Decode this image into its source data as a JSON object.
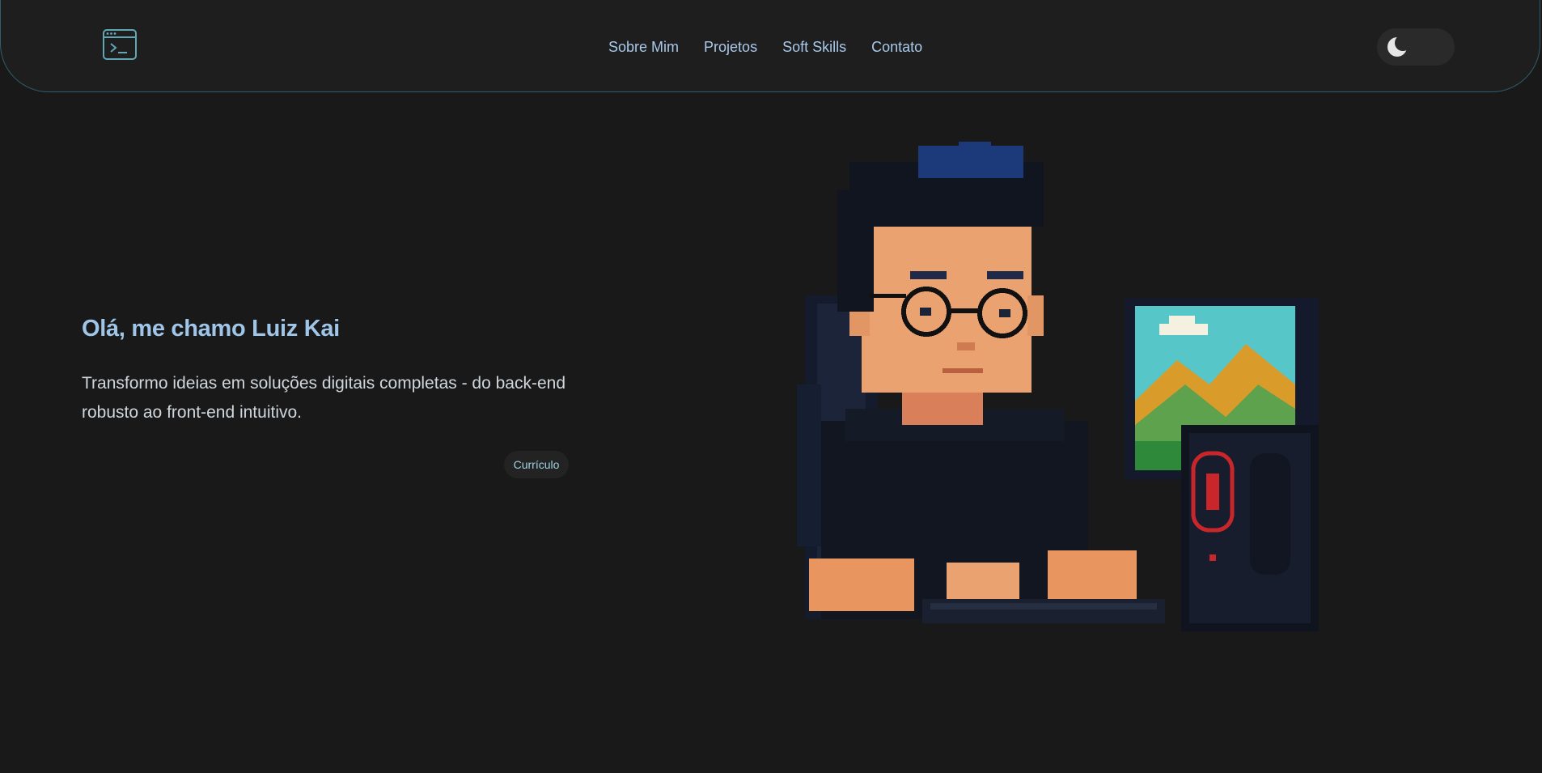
{
  "header": {
    "logo_icon": "terminal-icon",
    "nav": [
      {
        "label": "Sobre Mim"
      },
      {
        "label": "Projetos"
      },
      {
        "label": "Soft Skills"
      },
      {
        "label": "Contato"
      }
    ],
    "theme_toggle_icon": "moon-icon"
  },
  "hero": {
    "title": "Olá, me chamo Luiz Kai",
    "description": "Transformo ideias em soluções digitais completas - do back-end robusto ao front-end intuitivo.",
    "cv_button": "Currículo",
    "illustration": "pixel-art-developer-at-computer"
  },
  "colors": {
    "background": "#191919",
    "navbar": "#1e1e1e",
    "nav_border": "#2e5f6e",
    "accent": "#9fc6e8"
  }
}
